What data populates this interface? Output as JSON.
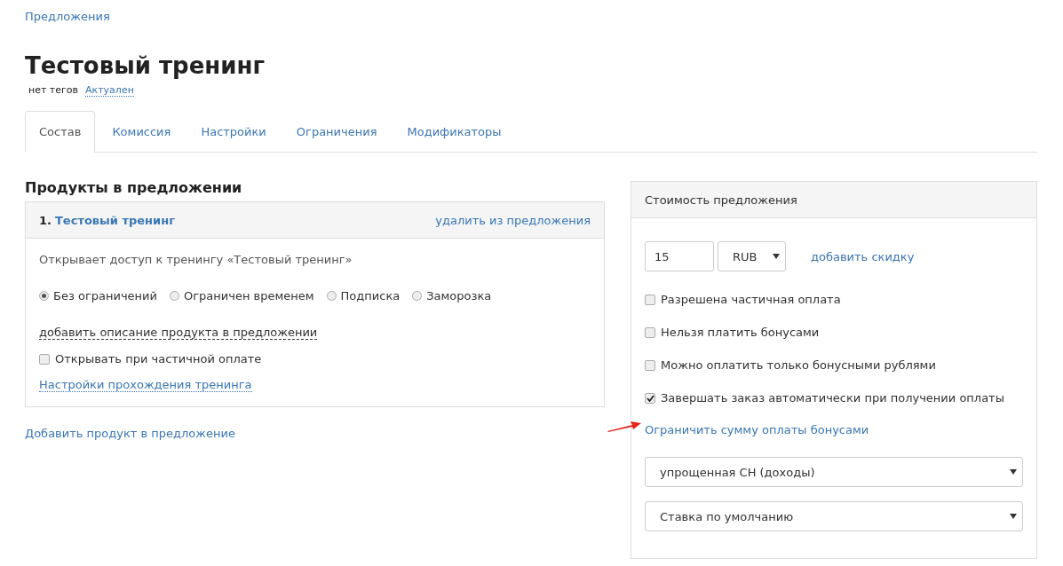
{
  "breadcrumb": "Предложения",
  "title": "Тестовый тренинг",
  "tags": "нет тегов",
  "status_link": "Актуален",
  "tabs": [
    {
      "label": "Состав",
      "selected": true
    },
    {
      "label": "Комиссия",
      "selected": false
    },
    {
      "label": "Настройки",
      "selected": false
    },
    {
      "label": "Ограничения",
      "selected": false
    },
    {
      "label": "Модификаторы",
      "selected": false
    }
  ],
  "products_heading": "Продукты в предложении",
  "product": {
    "number": "1.",
    "name": "Тестовый тренинг",
    "remove_link": "удалить из предложения",
    "description": "Открывает доступ к тренингу «Тестовый тренинг»",
    "access_options": [
      {
        "label": "Без ограничений",
        "selected": true
      },
      {
        "label": "Ограничен временем",
        "selected": false
      },
      {
        "label": "Подписка",
        "selected": false
      },
      {
        "label": "Заморозка",
        "selected": false
      }
    ],
    "add_description_link": "добавить описание продукта в предложении",
    "partial_open": {
      "label": "Открывать при частичной оплате",
      "checked": false
    },
    "settings_link": "Настройки прохождения тренинга"
  },
  "add_product_link": "Добавить продукт в предложение",
  "price_panel": {
    "title": "Стоимость предложения",
    "price": "15",
    "currency": "RUB",
    "discount_link": "добавить скидку",
    "options": [
      {
        "label": "Разрешена частичная оплата",
        "checked": false
      },
      {
        "label": "Нельзя платить бонусами",
        "checked": false
      },
      {
        "label": "Можно оплатить только бонусными рублями",
        "checked": false
      },
      {
        "label": "Завершать заказ автоматически при получении оплаты",
        "checked": true
      }
    ],
    "limit_bonus_link": "Ограничить сумму оплаты бонусами",
    "selects": [
      {
        "value": "упрощенная СН (доходы)"
      },
      {
        "value": "Ставка по умолчанию"
      }
    ]
  }
}
